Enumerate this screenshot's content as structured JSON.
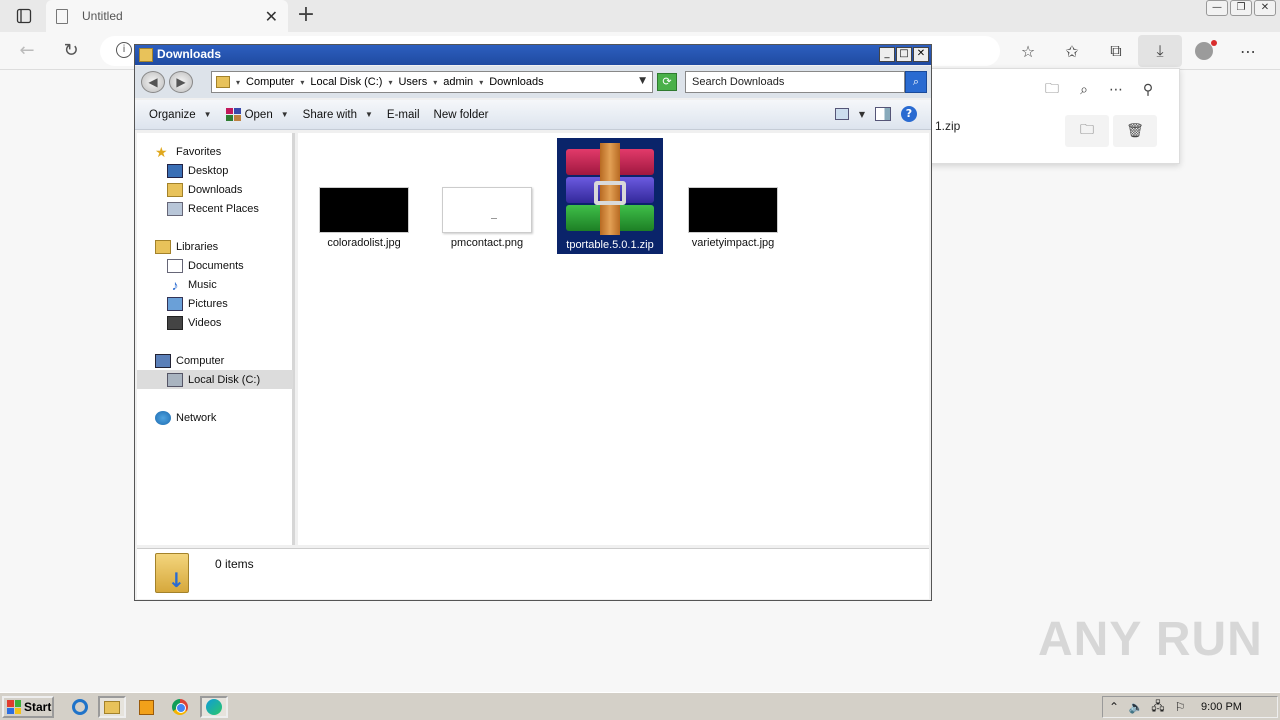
{
  "browser": {
    "tab_title": "Untitled",
    "new_tab_glyph": "+",
    "downloads_panel": {
      "file_name": "1.zip"
    }
  },
  "explorer": {
    "window_title": "Downloads",
    "breadcrumb": [
      "Computer",
      "Local Disk (C:)",
      "Users",
      "admin",
      "Downloads"
    ],
    "search_placeholder": "Search Downloads",
    "toolbar": {
      "organize": "Organize",
      "open": "Open",
      "share_with": "Share with",
      "email": "E-mail",
      "new_folder": "New folder"
    },
    "nav": {
      "favorites": "Favorites",
      "desktop": "Desktop",
      "downloads": "Downloads",
      "recent_places": "Recent Places",
      "libraries": "Libraries",
      "documents": "Documents",
      "music": "Music",
      "pictures": "Pictures",
      "videos": "Videos",
      "computer": "Computer",
      "local_disk": "Local Disk (C:)",
      "network": "Network"
    },
    "files": [
      {
        "name": "coloradolist.jpg",
        "thumb": "black"
      },
      {
        "name": "pmcontact.png",
        "thumb": "white"
      },
      {
        "name": "tportable.5.0.1.zip",
        "thumb": "winrar-icon",
        "selected": true
      },
      {
        "name": "varietyimpact.jpg",
        "thumb": "black"
      }
    ],
    "status": {
      "item_count": "0 items"
    }
  },
  "taskbar": {
    "start_label": "Start",
    "clock": "9:00 PM"
  },
  "watermark": "ANY RUN",
  "colors": {
    "titlebar": "#1f4aa1",
    "selection": "#0a246a",
    "taskbar": "#d4d0c8"
  }
}
